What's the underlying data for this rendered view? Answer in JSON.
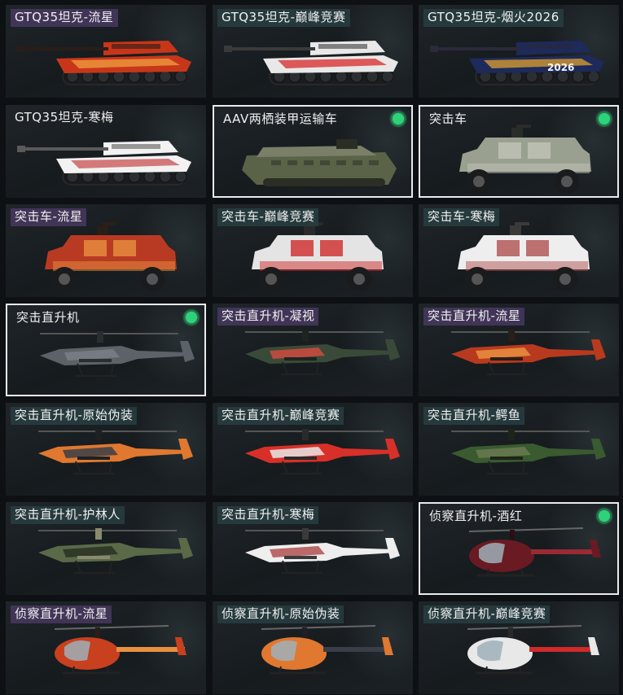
{
  "selected_indicator_color": "#2fd27a",
  "items": [
    {
      "label": "GTQ35坦克-流星",
      "kind": "tank",
      "skin": [
        "#c8361a",
        "#f0a040",
        "#2a1d18"
      ],
      "tint": "purple",
      "selected": false
    },
    {
      "label": "GTQ35坦克-巅峰竞赛",
      "kind": "tank",
      "skin": [
        "#e8e8e8",
        "#d8282a",
        "#3a3a3a"
      ],
      "tint": "teal",
      "selected": false
    },
    {
      "label": "GTQ35坦克-烟火2026",
      "kind": "tank",
      "skin": [
        "#1d2a5a",
        "#e0a030",
        "#2a2a3a"
      ],
      "tint": "teal",
      "selected": false,
      "decal": "2026"
    },
    {
      "label": "GTQ35坦克-寒梅",
      "kind": "tank",
      "skin": [
        "#f2f2f2",
        "#c85050",
        "#5a5a5a"
      ],
      "tint": "none",
      "selected": false
    },
    {
      "label": "AAV两栖装甲运输车",
      "kind": "aav",
      "skin": [
        "#5a6248",
        "#7a8068",
        "#2a2e24"
      ],
      "tint": "none",
      "selected": true
    },
    {
      "label": "突击车",
      "kind": "truck",
      "skin": [
        "#9aa090",
        "#c0c4b8",
        "#2a2c28"
      ],
      "tint": "none",
      "selected": true
    },
    {
      "label": "突击车-流星",
      "kind": "truck",
      "skin": [
        "#b83a22",
        "#e89040",
        "#2a1e18"
      ],
      "tint": "purple",
      "selected": false
    },
    {
      "label": "突击车-巅峰竞赛",
      "kind": "truck",
      "skin": [
        "#e4e4e4",
        "#d02a2a",
        "#2a2a2a"
      ],
      "tint": "teal",
      "selected": false
    },
    {
      "label": "突击车-寒梅",
      "kind": "truck",
      "skin": [
        "#eeeeee",
        "#b05050",
        "#3a3a3a"
      ],
      "tint": "teal",
      "selected": false
    },
    {
      "label": "突击直升机",
      "kind": "heli",
      "skin": [
        "#5c6268",
        "#7a8086",
        "#2a2e32"
      ],
      "tint": "none",
      "selected": true
    },
    {
      "label": "突击直升机-凝视",
      "kind": "heli",
      "skin": [
        "#3a4a38",
        "#d04a40",
        "#1e2420"
      ],
      "tint": "purple",
      "selected": false
    },
    {
      "label": "突击直升机-流星",
      "kind": "heli",
      "skin": [
        "#b83a1e",
        "#e89040",
        "#2a1e18"
      ],
      "tint": "purple",
      "selected": false
    },
    {
      "label": "突击直升机-原始伪装",
      "kind": "heli",
      "skin": [
        "#e07830",
        "#3a3e48",
        "#1e2024"
      ],
      "tint": "teal",
      "selected": false
    },
    {
      "label": "突击直升机-巅峰竞赛",
      "kind": "heli",
      "skin": [
        "#d83028",
        "#e8e8e8",
        "#2a2a2a"
      ],
      "tint": "teal",
      "selected": false
    },
    {
      "label": "突击直升机-鳄鱼",
      "kind": "heli",
      "skin": [
        "#3a5a30",
        "#6a7a50",
        "#1e2418"
      ],
      "tint": "teal",
      "selected": false
    },
    {
      "label": "突击直升机-护林人",
      "kind": "heli",
      "skin": [
        "#5a6a48",
        "#2a3024",
        "#8a8a70"
      ],
      "tint": "teal",
      "selected": false
    },
    {
      "label": "突击直升机-寒梅",
      "kind": "heli",
      "skin": [
        "#eeeeee",
        "#b05050",
        "#3a3a3a"
      ],
      "tint": "teal",
      "selected": false
    },
    {
      "label": "侦察直升机-酒红",
      "kind": "scout",
      "skin": [
        "#6a1a22",
        "#9a2a34",
        "#2a1014"
      ],
      "tint": "none",
      "selected": true
    },
    {
      "label": "侦察直升机-流星",
      "kind": "scout",
      "skin": [
        "#c8401e",
        "#e89040",
        "#2a1e18"
      ],
      "tint": "purple",
      "selected": false
    },
    {
      "label": "侦察直升机-原始伪装",
      "kind": "scout",
      "skin": [
        "#e07830",
        "#3a3e48",
        "#1e2024"
      ],
      "tint": "teal",
      "selected": false
    },
    {
      "label": "侦察直升机-巅峰竞赛",
      "kind": "scout",
      "skin": [
        "#e8e8e8",
        "#d02a2a",
        "#2a2a2a"
      ],
      "tint": "teal",
      "selected": false
    }
  ]
}
